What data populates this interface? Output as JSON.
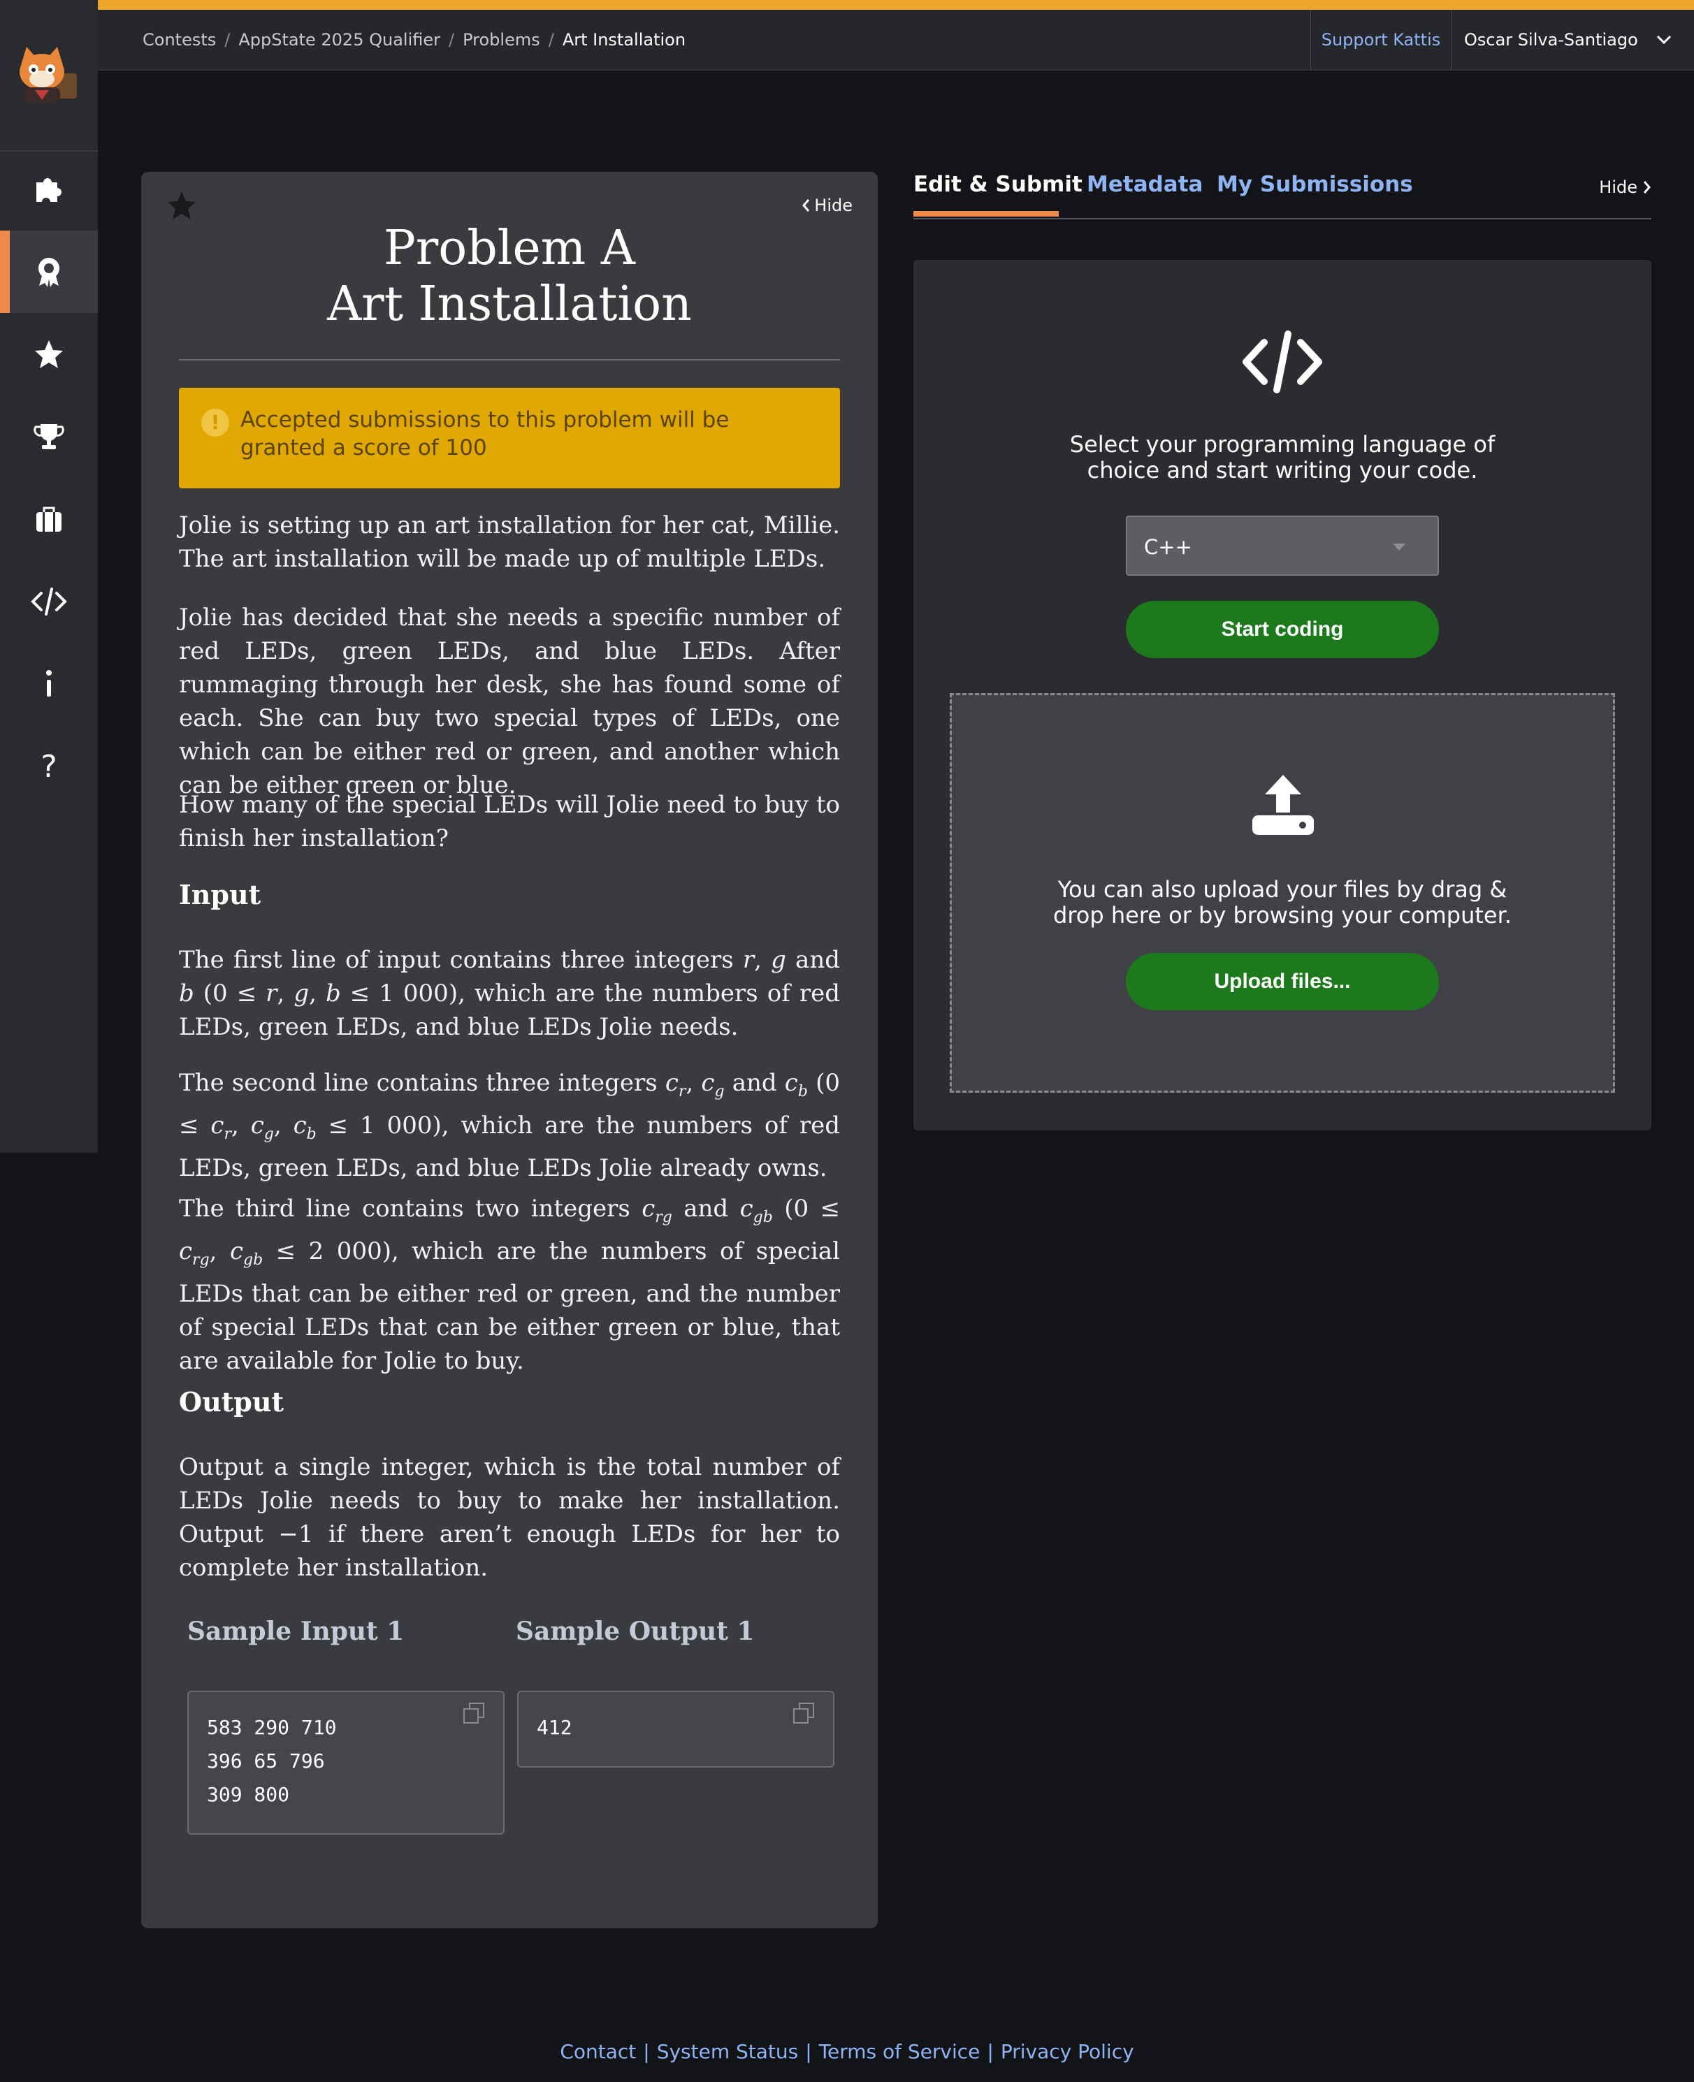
{
  "breadcrumb": [
    "Contests",
    "AppState 2025 Qualifier",
    "Problems",
    "Art Installation"
  ],
  "header": {
    "support_label": "Support Kattis",
    "user_name": "Oscar Silva-Santiago"
  },
  "sidebar": {
    "items": [
      {
        "icon": "puzzle-icon"
      },
      {
        "icon": "award-icon",
        "active": true
      },
      {
        "icon": "star-icon"
      },
      {
        "icon": "trophy-icon"
      },
      {
        "icon": "briefcase-icon"
      },
      {
        "icon": "code-icon"
      },
      {
        "icon": "info-icon"
      },
      {
        "icon": "help-icon"
      }
    ]
  },
  "problem": {
    "hide_label": "Hide",
    "title_line1": "Problem A",
    "title_line2": "Art Installation",
    "notice": "Accepted submissions to this problem will be granted a score of 100",
    "intro": "Jolie is setting up an art installation for her cat, Millie. The art installation will be made up of multiple LEDs.",
    "para2": "Jolie has decided that she needs a specific number of red LEDs, green LEDs, and blue LEDs. After rummaging through her desk, she has found some of each. She can buy two special types of LEDs, one which can be either red or green, and another which can be either green or blue.",
    "para3": "How many of the special LEDs will Jolie need to buy to finish her installation?",
    "input_heading": "Input",
    "output_heading": "Output",
    "output_text": "Output a single integer, which is the total number of LEDs Jolie needs to buy to make her installation. Output −1 if there aren’t enough LEDs for her to complete her installation.",
    "sample_input_heading": "Sample Input 1",
    "sample_output_heading": "Sample Output 1",
    "sample_input_lines": [
      "583 290 710",
      "396 65 796",
      "309 800"
    ],
    "sample_output_lines": [
      "412"
    ]
  },
  "tabs": [
    {
      "label": "Edit & Submit",
      "active": true
    },
    {
      "label": "Metadata"
    },
    {
      "label": "My Submissions"
    }
  ],
  "tabs_hide_label": "Hide",
  "editor": {
    "select_text_line1": "Select your programming language of",
    "select_text_line2": "choice and start writing your code.",
    "language": "C++",
    "start_label": "Start coding",
    "drop_text_line1": "You can also upload your files by drag &",
    "drop_text_line2": "drop here or by browsing your computer.",
    "upload_label": "Upload files..."
  },
  "footer": [
    "Contact",
    "System Status",
    "Terms of Service",
    "Privacy Policy"
  ],
  "colors": {
    "accent": "#f08a4b",
    "topbar": "#f0a52c",
    "notice": "#e0a800",
    "button": "#1c7a1c",
    "link": "#8fb4f5"
  }
}
